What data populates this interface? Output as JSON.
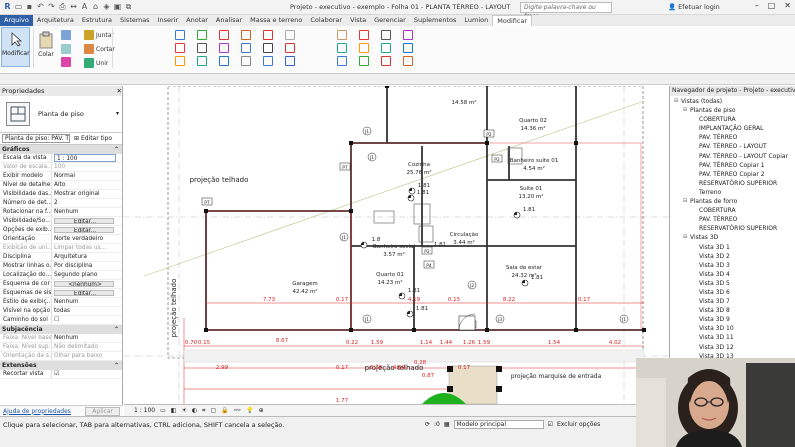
{
  "window": {
    "title": "Projeto - executivo - exemplo - Folha 01 - PLANTA TÉRREO - LAYOUT",
    "search_placeholder": "Digite palavra-chave ou frase",
    "login": "Efetuar login"
  },
  "menu": [
    "Arquivo",
    "Arquitetura",
    "Estrutura",
    "Sistemas",
    "Inserir",
    "Anotar",
    "Analisar",
    "Massa e terreno",
    "Colaborar",
    "Vista",
    "Gerenciar",
    "Suplementos",
    "Lumion",
    "Modificar"
  ],
  "ribbon": {
    "modify": "Modificar",
    "paste": "Colar",
    "tools": [
      {
        "label": "Juntar",
        "icon": "join-icon"
      },
      {
        "label": "Cortar",
        "icon": "cut-icon"
      },
      {
        "label": "Unir",
        "icon": "unite-icon"
      }
    ]
  },
  "properties": {
    "title": "Propriedades",
    "type_name": "Planta de piso",
    "plan_dropdown": "Planta de piso: PAV. TÉR",
    "edit_type": "Editar tipo",
    "sections": [
      {
        "name": "Gráficos",
        "rows": [
          {
            "label": "Escala da vista",
            "value": "1 : 100",
            "style": "input"
          },
          {
            "label": "Valor de escala...",
            "value": "100",
            "style": "dim"
          },
          {
            "label": "Exibir modelo",
            "value": "Normal"
          },
          {
            "label": "Nível de detalhe",
            "value": "Alto"
          },
          {
            "label": "Visibilidade das...",
            "value": "Mostrar original"
          },
          {
            "label": "Número de det...",
            "value": "2"
          },
          {
            "label": "Rotacionar na f...",
            "value": "Nenhum"
          },
          {
            "label": "Visibilidade/So...",
            "value": "Editar...",
            "style": "btn"
          },
          {
            "label": "Opções de exib...",
            "value": "Editar...",
            "style": "btn"
          },
          {
            "label": "Orientação",
            "value": "Norte verdadeiro"
          },
          {
            "label": "Exibição de uni...",
            "value": "Limpar todas us...",
            "style": "dim"
          },
          {
            "label": "Disciplina",
            "value": "Arquitetura"
          },
          {
            "label": "Mostrar linhas o...",
            "value": "Por disciplina"
          },
          {
            "label": "Localização do...",
            "value": "Segundo plano"
          },
          {
            "label": "Esquema de cor",
            "value": "<nenhum>",
            "style": "btn"
          },
          {
            "label": "Esquemas de sis...",
            "value": "Editar...",
            "style": "btn"
          },
          {
            "label": "Estilo de exibiç...",
            "value": "Nenhum"
          },
          {
            "label": "Visível na opção",
            "value": "todas"
          },
          {
            "label": "Caminho do sol",
            "value": "☐"
          }
        ]
      },
      {
        "name": "Subjacência",
        "rows": [
          {
            "label": "Faixa: Nível base",
            "value": "Nenhum",
            "style": "dim-l"
          },
          {
            "label": "Faixa: Nível sup...",
            "value": "Não delimitado",
            "style": "dim"
          },
          {
            "label": "Orientação da s...",
            "value": "Olhar para baixo",
            "style": "dim"
          }
        ]
      },
      {
        "name": "Extensões",
        "rows": [
          {
            "label": "Recortar vista",
            "value": "☑"
          }
        ]
      }
    ],
    "help_link": "Ajuda de propriedades",
    "apply": "Aplicar"
  },
  "plan": {
    "rooms": [
      {
        "name": "Cozinha",
        "area": "25.76 m²"
      },
      {
        "name": "Banheiro suíte 01",
        "area": "4.54 m²"
      },
      {
        "name": "Suíte 01",
        "area": "13.20 m²"
      },
      {
        "name": "Circulação",
        "area": "3.44 m²"
      },
      {
        "name": "Banheiro social",
        "area": "3.57 m²"
      },
      {
        "name": "Sala de estar",
        "area": "24.32 m²"
      },
      {
        "name": "Quarto 01",
        "area": "14.23 m²"
      },
      {
        "name": "Garagem",
        "area": "42.42 m²"
      },
      {
        "name": "Quarto 02",
        "area": "14.36 m²"
      },
      {
        "name": "",
        "area": "14.58 m²"
      }
    ],
    "levels": [
      "1.81",
      "1.81",
      "1.81",
      "1.81",
      "1.81",
      "1.81",
      "1.81",
      "1.8"
    ],
    "labels": [
      "projeção telhado",
      "projeção telhado",
      "projeção telhado",
      "projeção marquise de entrada"
    ],
    "dims_red": [
      "7.73",
      "0.17",
      "4.19",
      "0.15",
      "8.22",
      "0.17",
      "8.67",
      "2.99",
      "0.17",
      "4.69",
      "0.17",
      "0.70",
      "0.15",
      "0.22",
      "1.59",
      "1.14",
      "1.44",
      "1.26",
      "1.59",
      "1.54",
      "4.02",
      "0.87",
      "0.28",
      "0.78",
      "1.77"
    ],
    "tags": [
      "P7",
      "P7",
      "P2",
      "P2",
      "P2",
      "P4",
      "P1",
      "J1",
      "J1",
      "J1",
      "J2",
      "J1",
      "J3",
      "J1"
    ]
  },
  "view_scale": "1 : 100",
  "browser": {
    "title": "Navegador de projeto - Projeto - executivo - e...",
    "tree": [
      {
        "t": "Vistas (todas)",
        "lvl": 0,
        "tg": "⊟"
      },
      {
        "t": "Plantas de piso",
        "lvl": 1,
        "tg": "⊟"
      },
      {
        "t": "COBERTURA",
        "lvl": 2
      },
      {
        "t": "IMPLANTAÇÃO GERAL",
        "lvl": 2
      },
      {
        "t": "PAV. TÉRREO",
        "lvl": 2
      },
      {
        "t": "PAV. TÉRREO - LAYOUT",
        "lvl": 2
      },
      {
        "t": "PAV. TÉRREO - LAYOUT Copiar",
        "lvl": 2
      },
      {
        "t": "PAV. TÉRREO Copiar 1",
        "lvl": 2
      },
      {
        "t": "PAV. TÉRREO Copiar 2",
        "lvl": 2
      },
      {
        "t": "RESERVATÓRIO SUPERIOR",
        "lvl": 2
      },
      {
        "t": "Terreno",
        "lvl": 2
      },
      {
        "t": "Plantas de forro",
        "lvl": 1,
        "tg": "⊟"
      },
      {
        "t": "COBERTURA",
        "lvl": 2
      },
      {
        "t": "PAV. TÉRREO",
        "lvl": 2
      },
      {
        "t": "RESERVATÓRIO SUPERIOR",
        "lvl": 2
      },
      {
        "t": "Vistas 3D",
        "lvl": 1,
        "tg": "⊟"
      },
      {
        "t": "Vista 3D 1",
        "lvl": 2
      },
      {
        "t": "Vista 3D 2",
        "lvl": 2
      },
      {
        "t": "Vista 3D 3",
        "lvl": 2
      },
      {
        "t": "Vista 3D 4",
        "lvl": 2
      },
      {
        "t": "Vista 3D 5",
        "lvl": 2
      },
      {
        "t": "Vista 3D 6",
        "lvl": 2
      },
      {
        "t": "Vista 3D 7",
        "lvl": 2
      },
      {
        "t": "Vista 3D 8",
        "lvl": 2
      },
      {
        "t": "Vista 3D 9",
        "lvl": 2
      },
      {
        "t": "Vista 3D 10",
        "lvl": 2
      },
      {
        "t": "Vista 3D 11",
        "lvl": 2
      },
      {
        "t": "Vista 3D 12",
        "lvl": 2
      },
      {
        "t": "Vista 3D 13",
        "lvl": 2
      }
    ]
  },
  "status": {
    "text": "Clique para selecionar, TAB para alternativas, CTRL adiciona, SHIFT cancela a seleção.",
    "model": "Modelo principal",
    "exclude": "Excluir opções",
    "scale_value": ":0"
  },
  "colors": {
    "red": "#d22",
    "brand": "#2f5fa6"
  }
}
